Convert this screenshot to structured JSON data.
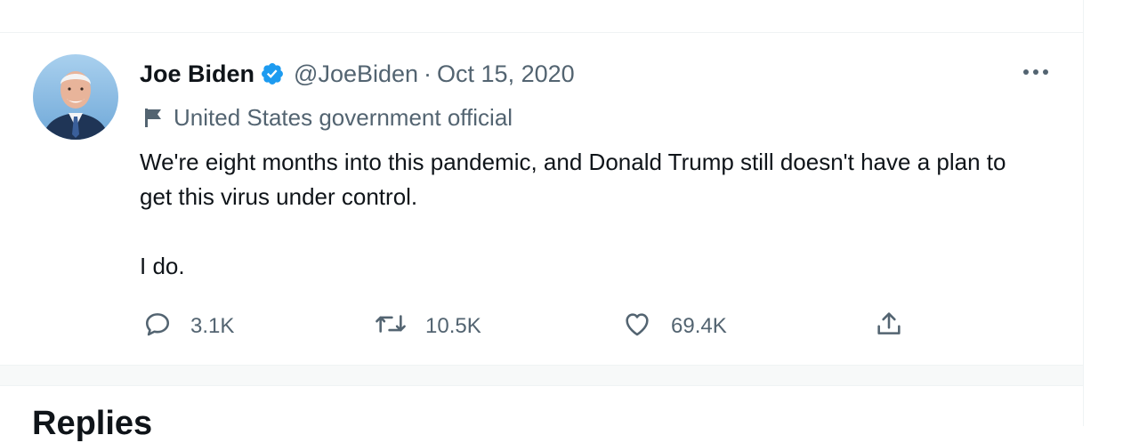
{
  "tweet": {
    "author": {
      "name": "Joe Biden",
      "handle": "@JoeBiden",
      "verified": true,
      "avatar_icon": "avatar-photo"
    },
    "separator": "·",
    "date": "Oct 15, 2020",
    "affiliation": {
      "icon": "flag-icon",
      "label": "United States government official"
    },
    "text": {
      "paragraph1": "We're eight months into this pandemic, and Donald Trump still doesn't have a plan to get this virus under control.",
      "paragraph2": "I do."
    },
    "actions": {
      "reply": {
        "icon": "reply-icon",
        "count": "3.1K"
      },
      "retweet": {
        "icon": "retweet-icon",
        "count": "10.5K"
      },
      "like": {
        "icon": "heart-icon",
        "count": "69.4K"
      },
      "share": {
        "icon": "share-icon"
      }
    },
    "more_icon": "more-icon"
  },
  "replies": {
    "title": "Replies"
  },
  "colors": {
    "text": "#0f1419",
    "secondary": "#536471",
    "verified": "#1d9bf0",
    "divider": "#eff3f4",
    "gap": "#f7f9f9"
  }
}
